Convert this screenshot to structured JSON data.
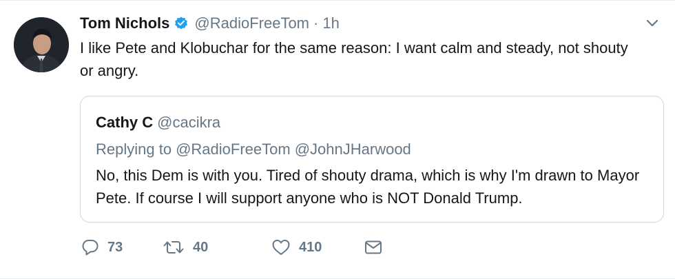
{
  "tweet": {
    "author": {
      "name": "Tom Nichols",
      "handle": "@RadioFreeTom",
      "avatar": "person-photo",
      "verified": true
    },
    "separator": "·",
    "time": "1h",
    "text": "I like Pete and Klobuchar for the same reason: I want calm and steady, not shouty or angry.",
    "menu_icon": "chevron-down-icon"
  },
  "quoted": {
    "name": "Cathy C",
    "handle": "@cacikra",
    "reply_prefix": "Replying to",
    "reply_to": [
      "@RadioFreeTom",
      "@JohnJHarwood"
    ],
    "text": "No, this Dem is with you. Tired of shouty drama, which is why I'm drawn to Mayor Pete. If course I will support anyone who is NOT Donald Trump."
  },
  "actions": {
    "reply": {
      "icon": "reply-icon",
      "count": "73"
    },
    "retweet": {
      "icon": "retweet-icon",
      "count": "40"
    },
    "like": {
      "icon": "heart-icon",
      "count": "410"
    },
    "message": {
      "icon": "mail-icon"
    }
  },
  "colors": {
    "text": "#14171a",
    "secondary": "#657786",
    "verified": "#1da1f2",
    "border": "#ccd6dd"
  }
}
